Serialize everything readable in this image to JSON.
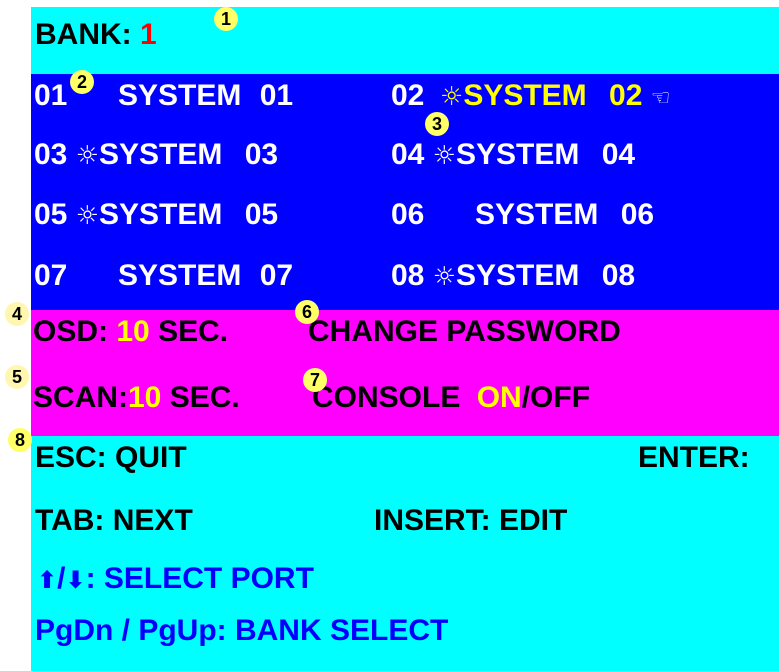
{
  "bank": {
    "label": "BANK:",
    "number": "1"
  },
  "ports": [
    {
      "num": "01",
      "name": "SYSTEM",
      "idx": "01",
      "sun": ""
    },
    {
      "num": "02",
      "name": "SYSTEM",
      "idx": "02",
      "sun": "☼"
    },
    {
      "num": "03",
      "name": "SYSTEM",
      "idx": "03",
      "sun": "☼"
    },
    {
      "num": "04",
      "name": "SYSTEM",
      "idx": "04",
      "sun": "☼"
    },
    {
      "num": "05",
      "name": "SYSTEM",
      "idx": "05",
      "sun": "☼"
    },
    {
      "num": "06",
      "name": "SYSTEM",
      "idx": "06",
      "sun": ""
    },
    {
      "num": "07",
      "name": "SYSTEM",
      "idx": "07",
      "sun": ""
    },
    {
      "num": "08",
      "name": "SYSTEM",
      "idx": "08",
      "sun": "☼"
    }
  ],
  "selected_hand": "☜",
  "osd": {
    "label": "OSD:",
    "value": "10",
    "unit": "SEC."
  },
  "scan": {
    "label": "SCAN:",
    "value": "10",
    "unit": "SEC."
  },
  "change_password": "CHANGE PASSWORD",
  "console": {
    "label": "CONSOLE",
    "on": "ON",
    "off": "/OFF"
  },
  "help": {
    "esc": "ESC: QUIT",
    "enter": "ENTER:",
    "tab": "TAB: NEXT",
    "insert": "INSERT: EDIT",
    "up_arrow": "⬆",
    "slash": "/",
    "down_arrow": "⬇",
    "select_port": ": SELECT PORT",
    "bank_select": "PgDn / PgUp: BANK SELECT"
  },
  "callouts": [
    "1",
    "2",
    "3",
    "4",
    "5",
    "6",
    "7",
    "8"
  ],
  "colors": {
    "cyan": "#00ffff",
    "blue": "#0000ff",
    "magenta": "#ff00ff",
    "yellow": "#ffff00",
    "red": "#ff0000"
  }
}
